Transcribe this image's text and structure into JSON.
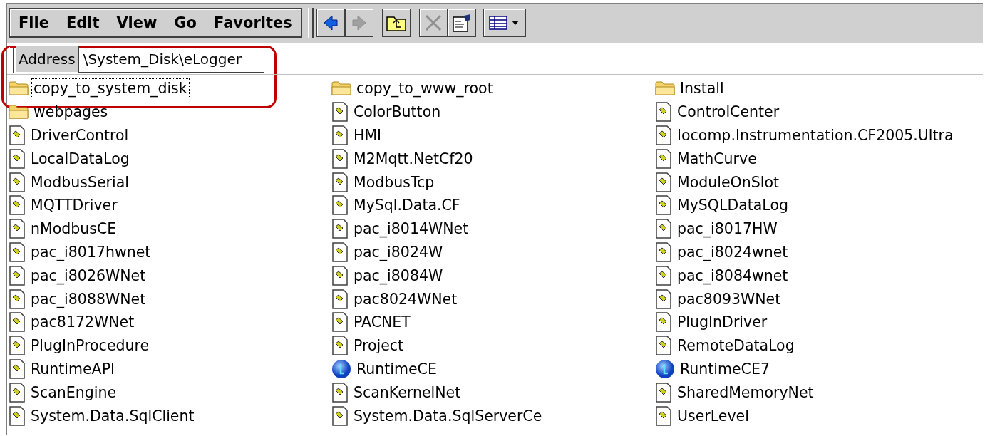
{
  "menu": [
    {
      "label": "File"
    },
    {
      "label": "Edit"
    },
    {
      "label": "View"
    },
    {
      "label": "Go"
    },
    {
      "label": "Favorites"
    }
  ],
  "toolbar": [
    {
      "kind": "back",
      "disabled": false
    },
    {
      "kind": "forward",
      "disabled": true
    },
    {
      "kind": "up",
      "disabled": false
    },
    {
      "kind": "delete",
      "disabled": true
    },
    {
      "kind": "properties",
      "disabled": false
    },
    {
      "kind": "views",
      "disabled": false
    }
  ],
  "address": {
    "label": "Address",
    "value": "\\System_Disk\\eLogger",
    "highlighted": true
  },
  "files": [
    {
      "name": "copy_to_system_disk",
      "kind": "folder",
      "selected": true
    },
    {
      "name": "copy_to_www_root",
      "kind": "folder",
      "selected": false
    },
    {
      "name": "Install",
      "kind": "folder",
      "selected": false
    },
    {
      "name": "webpages",
      "kind": "folder",
      "selected": false
    },
    {
      "name": "ColorButton",
      "kind": "library",
      "selected": false
    },
    {
      "name": "ControlCenter",
      "kind": "library",
      "selected": false
    },
    {
      "name": "DriverControl",
      "kind": "library",
      "selected": false
    },
    {
      "name": "HMI",
      "kind": "library",
      "selected": false
    },
    {
      "name": "Iocomp.Instrumentation.CF2005.Ultra",
      "kind": "library",
      "selected": false
    },
    {
      "name": "LocalDataLog",
      "kind": "library",
      "selected": false
    },
    {
      "name": "M2Mqtt.NetCf20",
      "kind": "library",
      "selected": false
    },
    {
      "name": "MathCurve",
      "kind": "library",
      "selected": false
    },
    {
      "name": "ModbusSerial",
      "kind": "library",
      "selected": false
    },
    {
      "name": "ModbusTcp",
      "kind": "library",
      "selected": false
    },
    {
      "name": "ModuleOnSlot",
      "kind": "library",
      "selected": false
    },
    {
      "name": "MQTTDriver",
      "kind": "library",
      "selected": false
    },
    {
      "name": "MySql.Data.CF",
      "kind": "library",
      "selected": false
    },
    {
      "name": "MySQLDataLog",
      "kind": "library",
      "selected": false
    },
    {
      "name": "nModbusCE",
      "kind": "library",
      "selected": false
    },
    {
      "name": "pac_i8014WNet",
      "kind": "library",
      "selected": false
    },
    {
      "name": "pac_i8017HW",
      "kind": "library",
      "selected": false
    },
    {
      "name": "pac_i8017hwnet",
      "kind": "library",
      "selected": false
    },
    {
      "name": "pac_i8024W",
      "kind": "library",
      "selected": false
    },
    {
      "name": "pac_i8024wnet",
      "kind": "library",
      "selected": false
    },
    {
      "name": "pac_i8026WNet",
      "kind": "library",
      "selected": false
    },
    {
      "name": "pac_i8084W",
      "kind": "library",
      "selected": false
    },
    {
      "name": "pac_i8084wnet",
      "kind": "library",
      "selected": false
    },
    {
      "name": "pac_i8088WNet",
      "kind": "library",
      "selected": false
    },
    {
      "name": "pac8024WNet",
      "kind": "library",
      "selected": false
    },
    {
      "name": "pac8093WNet",
      "kind": "library",
      "selected": false
    },
    {
      "name": "pac8172WNet",
      "kind": "library",
      "selected": false
    },
    {
      "name": "PACNET",
      "kind": "library",
      "selected": false
    },
    {
      "name": "PlugInDriver",
      "kind": "library",
      "selected": false
    },
    {
      "name": "PlugInProcedure",
      "kind": "library",
      "selected": false
    },
    {
      "name": "Project",
      "kind": "library",
      "selected": false
    },
    {
      "name": "RemoteDataLog",
      "kind": "library",
      "selected": false
    },
    {
      "name": "RuntimeAPI",
      "kind": "library",
      "selected": false
    },
    {
      "name": "RuntimeCE",
      "kind": "app",
      "selected": false
    },
    {
      "name": "RuntimeCE7",
      "kind": "app",
      "selected": false
    },
    {
      "name": "ScanEngine",
      "kind": "library",
      "selected": false
    },
    {
      "name": "ScanKernelNet",
      "kind": "library",
      "selected": false
    },
    {
      "name": "SharedMemoryNet",
      "kind": "library",
      "selected": false
    },
    {
      "name": "System.Data.SqlClient",
      "kind": "library",
      "selected": false
    },
    {
      "name": "System.Data.SqlServerCe",
      "kind": "library",
      "selected": false
    },
    {
      "name": "UserLevel",
      "kind": "library",
      "selected": false
    }
  ]
}
